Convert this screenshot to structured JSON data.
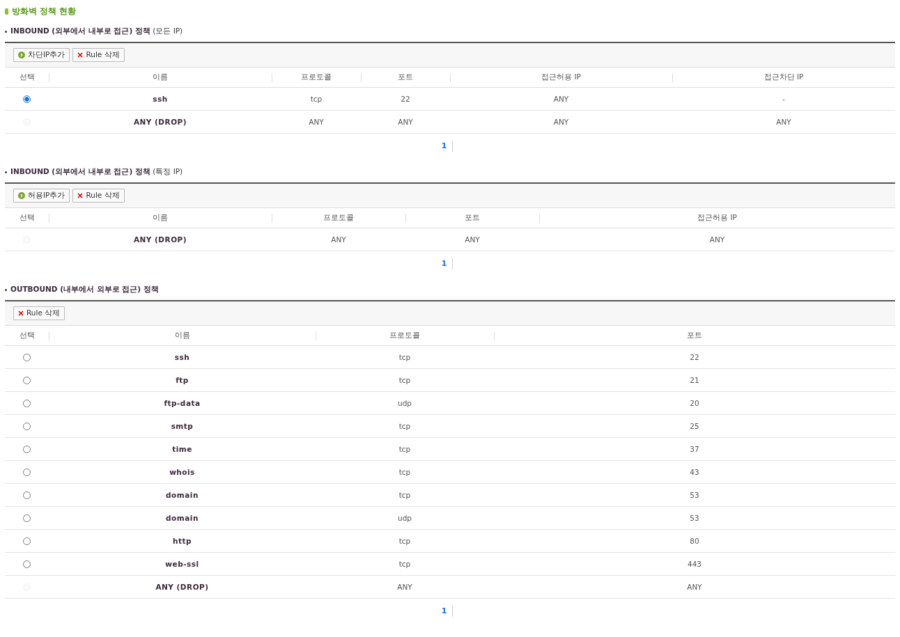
{
  "page_title": "방화벽 정책 현황",
  "sections": [
    {
      "title": "**INBOUND (외부에서 내부로 접근) 정책** (모든 IP)",
      "buttons": [
        {
          "kind": "add",
          "label": "차단IP추가"
        },
        {
          "kind": "delete",
          "label": "Rule 삭제"
        }
      ],
      "columns": [
        "선택",
        "이름",
        "프로토콜",
        "포트",
        "접근허용 IP",
        "접근차단 IP"
      ],
      "rows": [
        {
          "selected": true,
          "disabled": false,
          "cells": [
            "",
            "ssh",
            "tcp",
            "22",
            "ANY",
            "-"
          ]
        },
        {
          "selected": false,
          "disabled": true,
          "cells": [
            "",
            "ANY (DROP)",
            "ANY",
            "ANY",
            "ANY",
            "ANY"
          ]
        }
      ],
      "pages": [
        {
          "label": "1",
          "selected": true
        }
      ]
    },
    {
      "title": "**INBOUND (외부에서 내부로 접근) 정책** (특정 IP)",
      "buttons": [
        {
          "kind": "add",
          "label": "허용IP추가"
        },
        {
          "kind": "delete",
          "label": "Rule 삭제"
        }
      ],
      "columns": [
        "선택",
        "이름",
        "프로토콜",
        "포트",
        "접근허용 IP"
      ],
      "rows": [
        {
          "selected": false,
          "disabled": true,
          "cells": [
            "",
            "ANY (DROP)",
            "ANY",
            "ANY",
            "ANY"
          ]
        }
      ],
      "pages": [
        {
          "label": "1",
          "selected": true
        }
      ]
    },
    {
      "title": "**OUTBOUND (내부에서 외부로 접근) 정책**",
      "buttons": [
        {
          "kind": "delete",
          "label": "Rule 삭제"
        }
      ],
      "columns": [
        "선택",
        "이름",
        "프로토콜",
        "포트"
      ],
      "rows": [
        {
          "selected": false,
          "disabled": false,
          "cells": [
            "",
            "ssh",
            "tcp",
            "22"
          ]
        },
        {
          "selected": false,
          "disabled": false,
          "cells": [
            "",
            "ftp",
            "tcp",
            "21"
          ]
        },
        {
          "selected": false,
          "disabled": false,
          "cells": [
            "",
            "ftp-data",
            "udp",
            "20"
          ]
        },
        {
          "selected": false,
          "disabled": false,
          "cells": [
            "",
            "smtp",
            "tcp",
            "25"
          ]
        },
        {
          "selected": false,
          "disabled": false,
          "cells": [
            "",
            "time",
            "tcp",
            "37"
          ]
        },
        {
          "selected": false,
          "disabled": false,
          "cells": [
            "",
            "whois",
            "tcp",
            "43"
          ]
        },
        {
          "selected": false,
          "disabled": false,
          "cells": [
            "",
            "domain",
            "tcp",
            "53"
          ]
        },
        {
          "selected": false,
          "disabled": false,
          "cells": [
            "",
            "domain",
            "udp",
            "53"
          ]
        },
        {
          "selected": false,
          "disabled": false,
          "cells": [
            "",
            "http",
            "tcp",
            "80"
          ]
        },
        {
          "selected": false,
          "disabled": false,
          "cells": [
            "",
            "web-ssl",
            "tcp",
            "443"
          ]
        },
        {
          "selected": false,
          "disabled": true,
          "cells": [
            "",
            "ANY (DROP)",
            "ANY",
            "ANY"
          ]
        }
      ],
      "pages": [
        {
          "label": "1",
          "selected": true
        }
      ]
    }
  ]
}
